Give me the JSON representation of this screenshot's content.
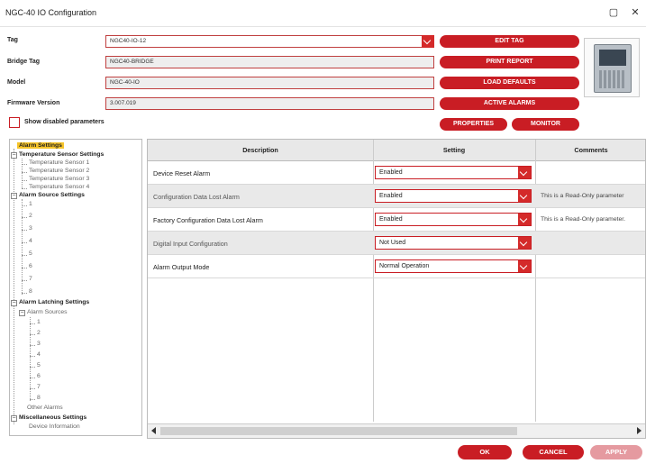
{
  "window": {
    "title": "NGC-40 IO Configuration",
    "minimize_glyph": "▢",
    "close_glyph": "✕"
  },
  "fields": {
    "tag": {
      "label": "Tag",
      "value": "NGC40-IO-12"
    },
    "bridge_tag": {
      "label": "Bridge Tag",
      "value": "NGC40-BRIDGE"
    },
    "model": {
      "label": "Model",
      "value": "NGC-40-IO"
    },
    "firmware": {
      "label": "Firmware Version",
      "value": "3.007.019"
    }
  },
  "actions": {
    "edit_tag": "EDIT TAG",
    "print_report": "PRINT REPORT",
    "load_defaults": "LOAD DEFAULTS",
    "active_alarms": "ACTIVE ALARMS",
    "properties": "PROPERTIES",
    "monitor": "MONITOR"
  },
  "show_disabled": {
    "label": "Show disabled parameters",
    "checked": false
  },
  "tree": {
    "alarm_settings": "Alarm Settings",
    "temp_sensor_settings": "Temperature Sensor Settings",
    "temp_sensors": [
      "Temperature Sensor 1",
      "Temperature Sensor 2",
      "Temperature Sensor 3",
      "Temperature Sensor 4"
    ],
    "alarm_source_settings": "Alarm Source Settings",
    "alarm_sources": [
      "1",
      "2",
      "3",
      "4",
      "5",
      "6",
      "7",
      "8"
    ],
    "alarm_latching_settings": "Alarm Latching Settings",
    "latching_alarm_sources": "Alarm Sources",
    "latching_sources": [
      "1",
      "2",
      "3",
      "4",
      "5",
      "6",
      "7",
      "8"
    ],
    "other_alarms": "Other Alarms",
    "misc_settings": "Miscellaneous Settings",
    "device_information": "Device Information"
  },
  "table": {
    "headers": {
      "description": "Description",
      "setting": "Setting",
      "comments": "Comments"
    },
    "rows": [
      {
        "description": "Device Reset Alarm",
        "setting": "Enabled",
        "comment": ""
      },
      {
        "description": "Configuration Data Lost Alarm",
        "setting": "Enabled",
        "comment": "This is a Read-Only parameter"
      },
      {
        "description": "Factory Configuration Data Lost Alarm",
        "setting": "Enabled",
        "comment": "This is a Read-Only parameter."
      },
      {
        "description": "Digital Input Configuration",
        "setting": "Not Used",
        "comment": ""
      },
      {
        "description": "Alarm Output Mode",
        "setting": "Normal Operation",
        "comment": ""
      }
    ]
  },
  "footer": {
    "ok": "OK",
    "cancel": "CANCEL",
    "apply": "APPLY"
  },
  "colors": {
    "accent": "#c91d24",
    "apply_disabled": "#e59aa0",
    "selection": "#f7c52b"
  }
}
